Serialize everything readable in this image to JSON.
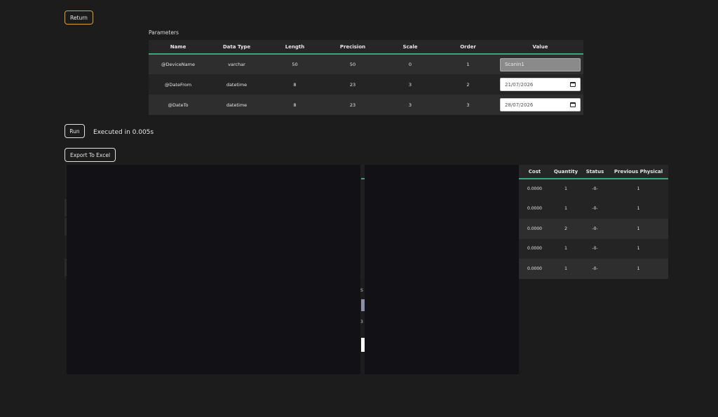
{
  "buttons": {
    "return": "Return",
    "run": "Run",
    "export": "Export To Excel"
  },
  "execution": {
    "text": "Executed in 0.005s"
  },
  "parameters": {
    "label": "Parameters",
    "headers": [
      "Name",
      "Data Type",
      "Length",
      "Precision",
      "Scale",
      "Order",
      "Value"
    ],
    "rows": [
      {
        "name": "@DeviceName",
        "type": "varchar",
        "length": "50",
        "precision": "50",
        "scale": "0",
        "order": "1",
        "value": "Scanin1"
      },
      {
        "name": "@DateFrom",
        "type": "datetime",
        "length": "8",
        "precision": "23",
        "scale": "3",
        "order": "2",
        "value": "21/07/2026"
      },
      {
        "name": "@DateTo",
        "type": "datetime",
        "length": "8",
        "precision": "23",
        "scale": "3",
        "order": "3",
        "value": "28/07/2026"
      }
    ]
  },
  "results": {
    "headers": [
      "Cost",
      "Quantity",
      "Status",
      "Previous Physical"
    ],
    "rows": [
      {
        "cost": "0.0000",
        "quantity": "1",
        "status": "-0-",
        "previous": "1"
      },
      {
        "cost": "0.0000",
        "quantity": "1",
        "status": "-0-",
        "previous": "1"
      },
      {
        "cost": "0.0000",
        "quantity": "2",
        "status": "-0-",
        "previous": "1"
      },
      {
        "cost": "0.0000",
        "quantity": "1",
        "status": "-0-",
        "previous": "1"
      },
      {
        "cost": "0.0000",
        "quantity": "1",
        "status": "-0-",
        "previous": "1"
      }
    ]
  },
  "fragments": {
    "a": "S",
    "b": "3"
  },
  "colors": {
    "accent": "#3aa77a",
    "return_border": "#e0a020",
    "background": "#1c1c1c"
  }
}
